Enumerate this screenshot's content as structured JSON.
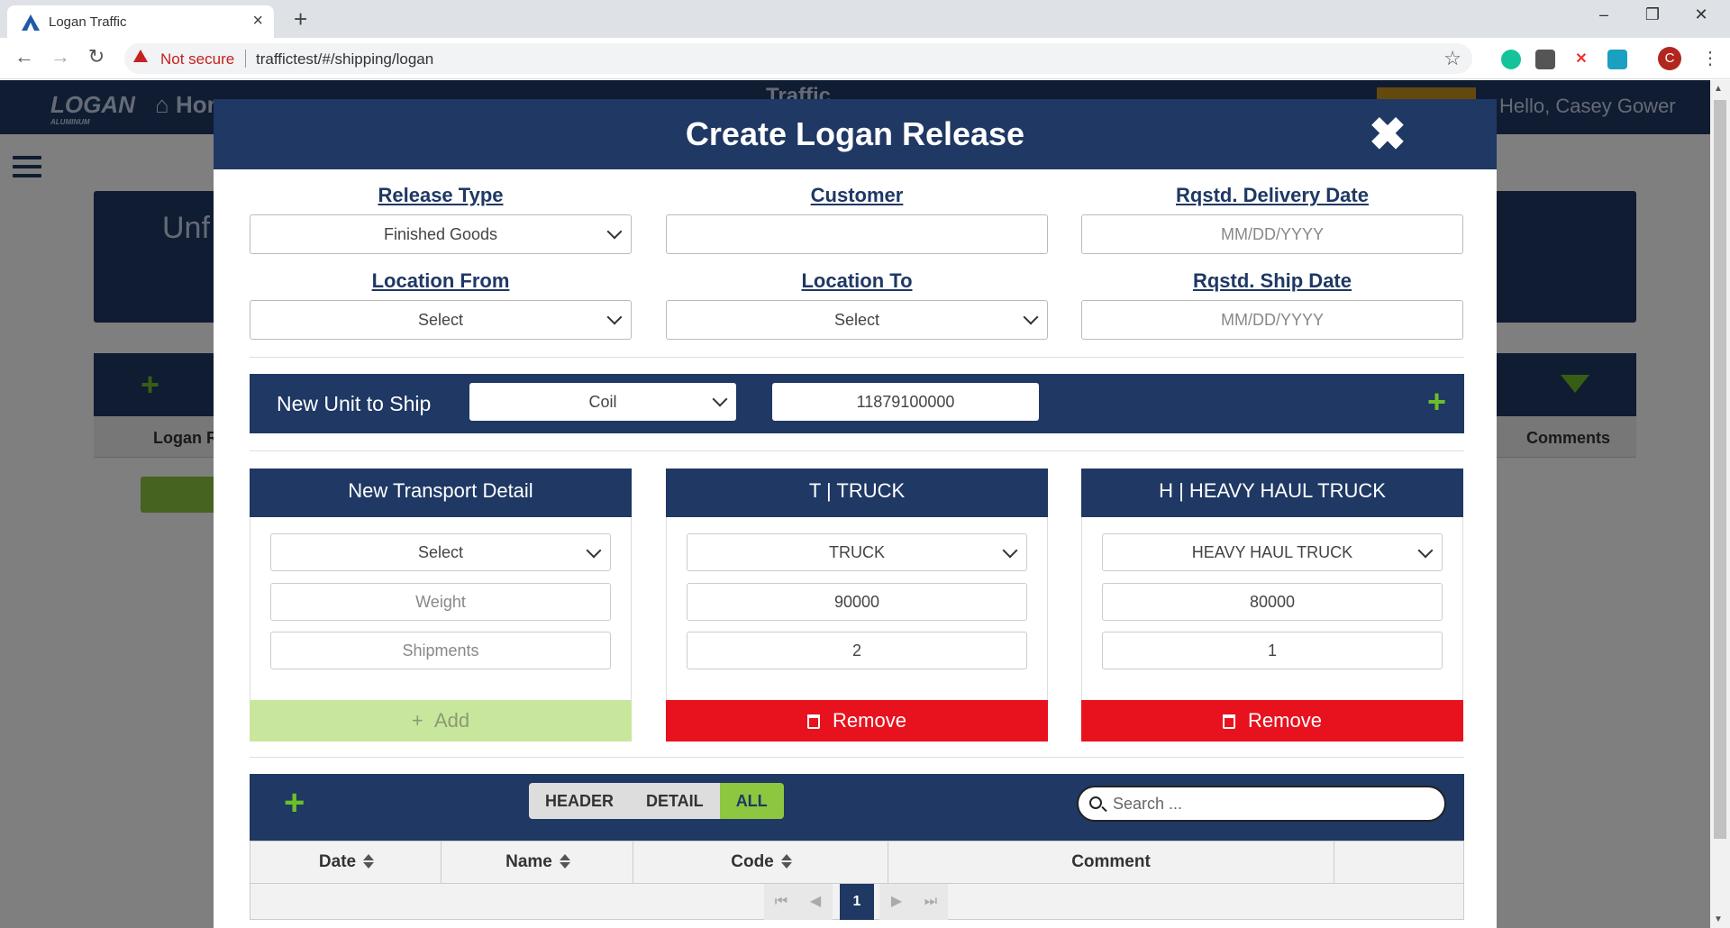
{
  "browser": {
    "tab_title": "Logan Traffic",
    "security": "Not secure",
    "url": "traffictest/#/shipping/logan",
    "profile_initial": "C"
  },
  "app": {
    "logo": "LOGAN",
    "logo_sub": "ALUMINUM",
    "home": "Home",
    "nav_title": "Traffic",
    "greeting": "Hello, Casey Gower",
    "page_heading": "Unf",
    "table_col_1": "Logan R",
    "table_col_2": "Comments"
  },
  "modal": {
    "title": "Create Logan Release",
    "fields": {
      "release_type": {
        "label": "Release Type",
        "value": "Finished Goods"
      },
      "customer": {
        "label": "Customer",
        "value": ""
      },
      "delivery_date": {
        "label": "Rqstd. Delivery Date",
        "placeholder": "MM/DD/YYYY"
      },
      "location_from": {
        "label": "Location From",
        "value": "Select"
      },
      "location_to": {
        "label": "Location To",
        "value": "Select"
      },
      "ship_date": {
        "label": "Rqstd. Ship Date",
        "placeholder": "MM/DD/YYYY"
      }
    },
    "unit": {
      "label": "New Unit to Ship",
      "type": "Coil",
      "number": "11879100000"
    },
    "transports": [
      {
        "title": "New Transport Detail",
        "select": "Select",
        "weight": "Weight",
        "shipments": "Shipments",
        "button": "Add"
      },
      {
        "title": "T | TRUCK",
        "select": "TRUCK",
        "weight": "90000",
        "shipments": "2",
        "button": "Remove"
      },
      {
        "title": "H | HEAVY HAUL TRUCK",
        "select": "HEAVY HAUL TRUCK",
        "weight": "80000",
        "shipments": "1",
        "button": "Remove"
      }
    ],
    "grid": {
      "views": [
        "HEADER",
        "DETAIL",
        "ALL"
      ],
      "active_view": "ALL",
      "search_placeholder": "Search ...",
      "columns": [
        "Date",
        "Name",
        "Code",
        "Comment"
      ],
      "page": "1"
    }
  },
  "colors": {
    "navy": "#1f3864",
    "green": "#6cbf2a",
    "red": "#e8111e"
  }
}
